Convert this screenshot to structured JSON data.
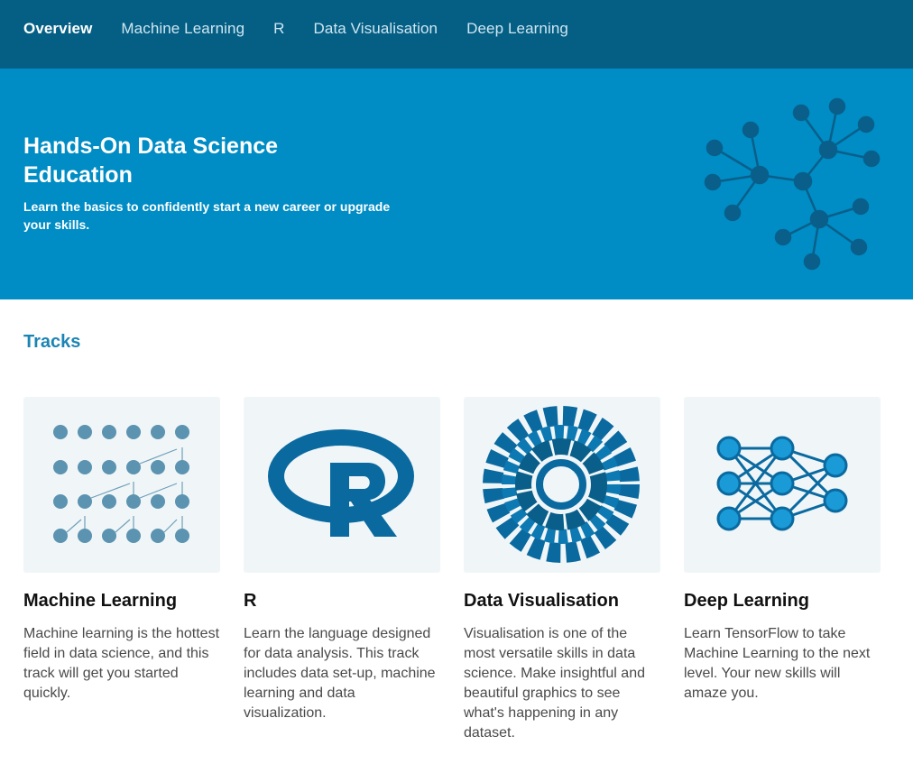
{
  "nav": {
    "items": [
      "Overview",
      "Machine Learning",
      "R",
      "Data Visualisation",
      "Deep Learning"
    ]
  },
  "hero": {
    "title": "Hands-On Data Science Education",
    "subtitle": "Learn the basics to confidently start a new career or upgrade your skills."
  },
  "tracks": {
    "heading": "Tracks",
    "cards": [
      {
        "title": "Machine Learning",
        "description": "Machine learning is the hottest field in data science, and this track will get you started quickly.",
        "icon": "dots-grid-icon"
      },
      {
        "title": "R",
        "description": "Learn the language designed for data analysis. This track includes data set-up, machine learning and data visualization.",
        "icon": "r-logo-icon"
      },
      {
        "title": "Data Visualisation",
        "description": "Visualisation is one of the most versatile skills in data science. Make insightful and beautiful graphics to see what's happening in any dataset.",
        "icon": "radial-chart-icon"
      },
      {
        "title": "Deep Learning",
        "description": "Learn TensorFlow to take Machine Learning to the next level. Your new skills will amaze you.",
        "icon": "neural-network-icon"
      }
    ]
  },
  "colors": {
    "nav_bg": "#055f85",
    "hero_bg": "#008cc4",
    "accent": "#1c84b4",
    "icon_blue": "#0a6aa0"
  }
}
